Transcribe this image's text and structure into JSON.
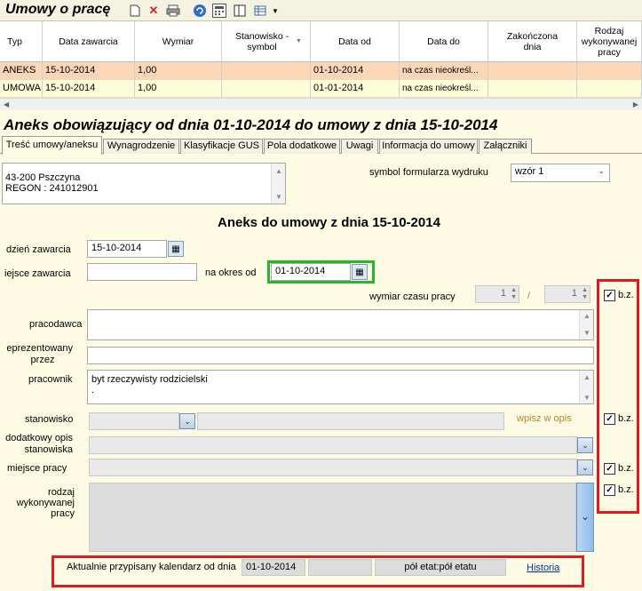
{
  "toolbar": {
    "title": "Umowy o pracę",
    "icons": [
      "new-document-icon",
      "delete-icon",
      "print-icon",
      "refresh-icon",
      "calculator-icon",
      "layout-icon",
      "grid-view-icon",
      "dropdown-arrow-icon"
    ]
  },
  "grid": {
    "columns": [
      "Typ",
      "Data zawarcia",
      "Wymiar",
      "Stanowisko - symbol",
      "Data od",
      "Data do",
      "Zakończona dnia",
      "Rodzaj wykonywanej pracy"
    ],
    "rows": [
      [
        "ANEKS",
        "15-10-2014",
        "1,00",
        "",
        "01-10-2014",
        "na czas nieokreśl...",
        "",
        ""
      ],
      [
        "UMOWA",
        "15-10-2014",
        "1,00",
        "",
        "01-01-2014",
        "na czas nieokreśl...",
        "",
        ""
      ]
    ]
  },
  "heading": "Aneks obowiązujący od dnia 01-10-2014 do umowy z dnia 15-10-2014",
  "tabs": [
    "Treść umowy/aneksu",
    "Wynagrodzenie",
    "Klasyfikacje GUS",
    "Pola dodatkowe",
    "Uwagi",
    "Informacja do umowy",
    "Załączniki"
  ],
  "form": {
    "address_line1": "43-200 Pszczyna",
    "address_line2": "REGON : 241012901",
    "print_symbol_label": "symbol formularza wydruku",
    "print_symbol_value": "wzór 1",
    "doc_title": "Aneks do umowy z dnia 15-10-2014",
    "date_label": "dzień zawarcia",
    "date_value": "15-10-2014",
    "place_label": "iejsce zawarcia",
    "place_value": "",
    "period_label": "na okres od",
    "period_value": "01-10-2014",
    "worktime_label": "wymiar czasu pracy",
    "worktime_num": "1",
    "worktime_sep": "/",
    "worktime_den": "1",
    "employer_label": "pracodawca",
    "represented_label_1": "eprezentowany",
    "represented_label_2": "przez",
    "employee_label": "pracownik",
    "employee_value_1": "byt rzeczywisty rodzicielski",
    "employee_value_2": ".",
    "position_label": "stanowisko",
    "position_hint": "wpisz w opis",
    "extra_desc_label_1": "dodatkowy opis",
    "extra_desc_label_2": "stanowiska",
    "workplace_label": "miejsce  pracy",
    "worktype_label_1": "rodzaj",
    "worktype_label_2": "wykonywanej",
    "worktype_label_3": "pracy",
    "bz": "b.z."
  },
  "calendar": {
    "label": "Aktualnie przypisany kalendarz od dnia",
    "date": "01-10-2014",
    "blank": "",
    "etat": "pół etat:pół etatu",
    "link": "Historia"
  }
}
